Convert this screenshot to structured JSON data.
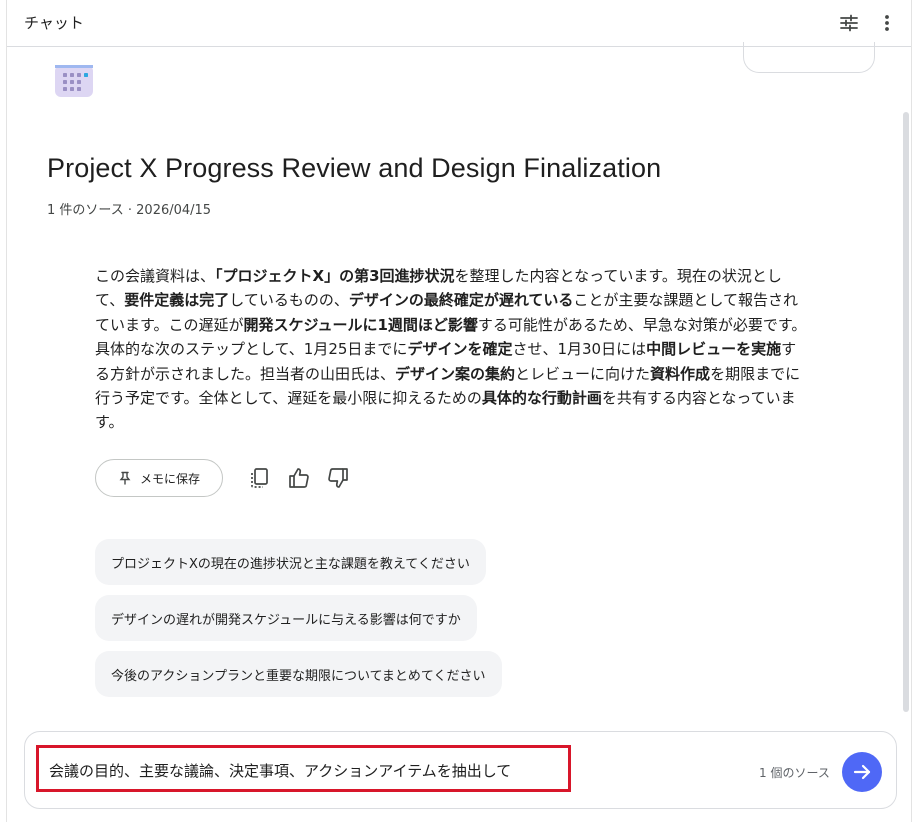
{
  "header": {
    "title": "チャット"
  },
  "document": {
    "title": "Project X Progress Review and Design Finalization",
    "meta": "1 件のソース · 2026/04/15"
  },
  "summary": {
    "segments": [
      {
        "t": "この会議資料は、",
        "b": false
      },
      {
        "t": "「プロジェクトX」の第3回進捗状況",
        "b": true
      },
      {
        "t": "を整理した内容となっています。現在の状況として、",
        "b": false
      },
      {
        "t": "要件定義は完了",
        "b": true
      },
      {
        "t": "しているものの、",
        "b": false
      },
      {
        "t": "デザインの最終確定が遅れている",
        "b": true
      },
      {
        "t": "ことが主要な課題として報告されています。この遅延が",
        "b": false
      },
      {
        "t": "開発スケジュールに1週間ほど影響",
        "b": true
      },
      {
        "t": "する可能性があるため、早急な対策が必要です。具体的な次のステップとして、1月25日までに",
        "b": false
      },
      {
        "t": "デザインを確定",
        "b": true
      },
      {
        "t": "させ、1月30日には",
        "b": false
      },
      {
        "t": "中間レビューを実施",
        "b": true
      },
      {
        "t": "する方針が示されました。担当者の山田氏は、",
        "b": false
      },
      {
        "t": "デザイン案の集約",
        "b": true
      },
      {
        "t": "とレビューに向けた",
        "b": false
      },
      {
        "t": "資料作成",
        "b": true
      },
      {
        "t": "を期限までに行う予定です。全体として、遅延を最小限に抑えるための",
        "b": false
      },
      {
        "t": "具体的な行動計画",
        "b": true
      },
      {
        "t": "を共有する内容となっています。",
        "b": false
      }
    ]
  },
  "actions": {
    "save_note_label": "メモに保存",
    "icons": [
      "copy-icon",
      "thumb-up-icon",
      "thumb-down-icon"
    ]
  },
  "suggestions": [
    "プロジェクトXの現在の進捗状況と主な課題を教えてください",
    "デザインの遅れが開発スケジュールに与える影響は何ですか",
    "今後のアクションプランと重要な期限についてまとめてください"
  ],
  "input": {
    "value": "会議の目的、主要な議論、決定事項、アクションアイテムを抽出して",
    "source_count": "1 個のソース"
  },
  "colors": {
    "accent": "#4f68f6",
    "highlight": "#d8162a",
    "chip_bg": "#f3f4f6"
  }
}
